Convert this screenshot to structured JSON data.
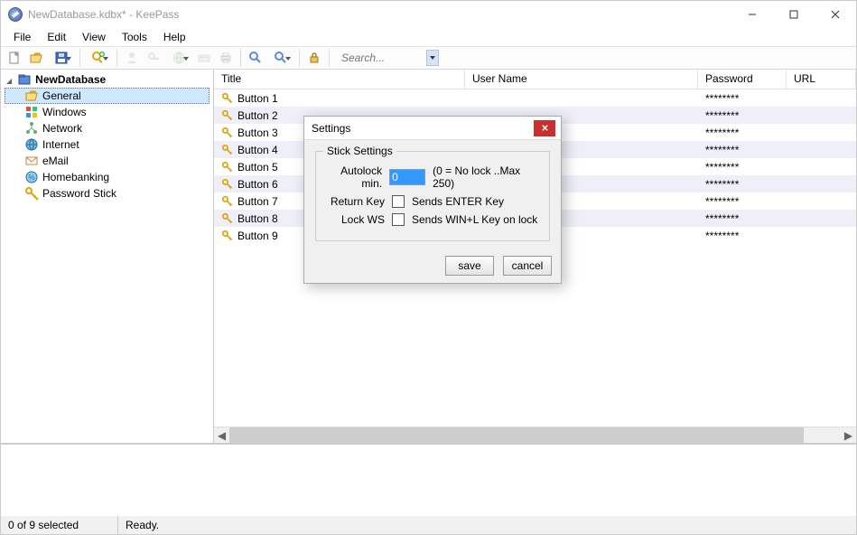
{
  "window": {
    "title": "NewDatabase.kdbx* - KeePass"
  },
  "menu": [
    "File",
    "Edit",
    "View",
    "Tools",
    "Help"
  ],
  "toolbar": {
    "new": "new-icon",
    "open": "open-icon",
    "save": "save-icon",
    "print": "print-icon",
    "addEntry": "add-entry-icon",
    "copyUser": "copy-user-icon",
    "copyPass": "copy-password-icon",
    "openUrl": "open-url-icon",
    "autoType": "autotype-icon",
    "find": "find-icon",
    "showAll": "show-all-icon",
    "lock": "lock-icon",
    "search_placeholder": "Search..."
  },
  "tree": {
    "root": "NewDatabase",
    "items": [
      {
        "label": "General",
        "icon": "folder-open-icon",
        "selected": true
      },
      {
        "label": "Windows",
        "icon": "windows-icon"
      },
      {
        "label": "Network",
        "icon": "network-icon"
      },
      {
        "label": "Internet",
        "icon": "globe-icon"
      },
      {
        "label": "eMail",
        "icon": "mail-icon"
      },
      {
        "label": "Homebanking",
        "icon": "homebanking-icon"
      },
      {
        "label": "Password Stick",
        "icon": "key-icon"
      }
    ]
  },
  "list": {
    "columns": {
      "title": "Title",
      "user": "User Name",
      "pass": "Password",
      "url": "URL"
    },
    "rows": [
      {
        "title": "Button 1",
        "user": "",
        "pass": "********",
        "url": ""
      },
      {
        "title": "Button 2",
        "user": "",
        "pass": "********",
        "url": ""
      },
      {
        "title": "Button 3",
        "user": "",
        "pass": "********",
        "url": ""
      },
      {
        "title": "Button 4",
        "user": "",
        "pass": "********",
        "url": ""
      },
      {
        "title": "Button 5",
        "user": "",
        "pass": "********",
        "url": ""
      },
      {
        "title": "Button 6",
        "user": "",
        "pass": "********",
        "url": ""
      },
      {
        "title": "Button 7",
        "user": "",
        "pass": "********",
        "url": ""
      },
      {
        "title": "Button 8",
        "user": "",
        "pass": "********",
        "url": ""
      },
      {
        "title": "Button 9",
        "user": "",
        "pass": "********",
        "url": ""
      }
    ]
  },
  "dialog": {
    "title": "Settings",
    "group": "Stick Settings",
    "rows": {
      "autolock_label": "Autolock min.",
      "autolock_value": "0",
      "autolock_hint": "(0 = No lock ..Max 250)",
      "return_label": "Return Key",
      "return_desc": "Sends ENTER Key",
      "lockws_label": "Lock WS",
      "lockws_desc": "Sends WIN+L Key on lock"
    },
    "buttons": {
      "save": "save",
      "cancel": "cancel"
    }
  },
  "status": {
    "selection": "0 of 9 selected",
    "ready": "Ready."
  }
}
